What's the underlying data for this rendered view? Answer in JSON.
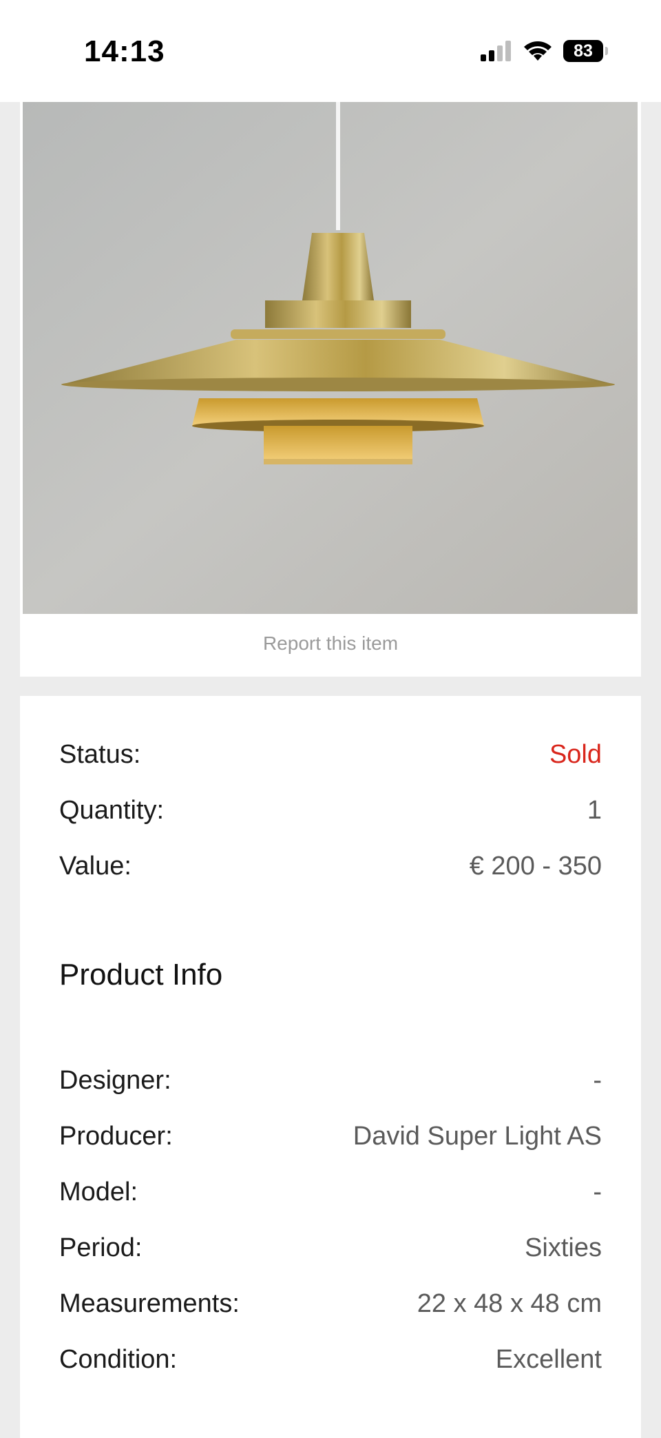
{
  "status_bar": {
    "time": "14:13",
    "battery": "83",
    "icons": [
      "signal-icon",
      "wifi-icon",
      "battery-icon"
    ]
  },
  "product": {
    "image_alt": "brass-pendant-lamp",
    "report_link": "Report this item"
  },
  "summary": [
    {
      "label": "Status:",
      "value": "Sold"
    },
    {
      "label": "Quantity:",
      "value": "1"
    },
    {
      "label": "Value:",
      "value": "€ 200 - 350"
    }
  ],
  "product_info": {
    "title": "Product Info",
    "rows": [
      {
        "label": "Designer:",
        "value": "-"
      },
      {
        "label": "Producer:",
        "value": "David Super Light AS"
      },
      {
        "label": "Model:",
        "value": "-"
      },
      {
        "label": "Period:",
        "value": "Sixties"
      },
      {
        "label": "Measurements:",
        "value": "22 x 48 x 48 cm"
      },
      {
        "label": "Condition:",
        "value": "Excellent"
      }
    ]
  },
  "colors": {
    "sold": "#d9261c",
    "background": "#ececec",
    "card": "#ffffff"
  }
}
